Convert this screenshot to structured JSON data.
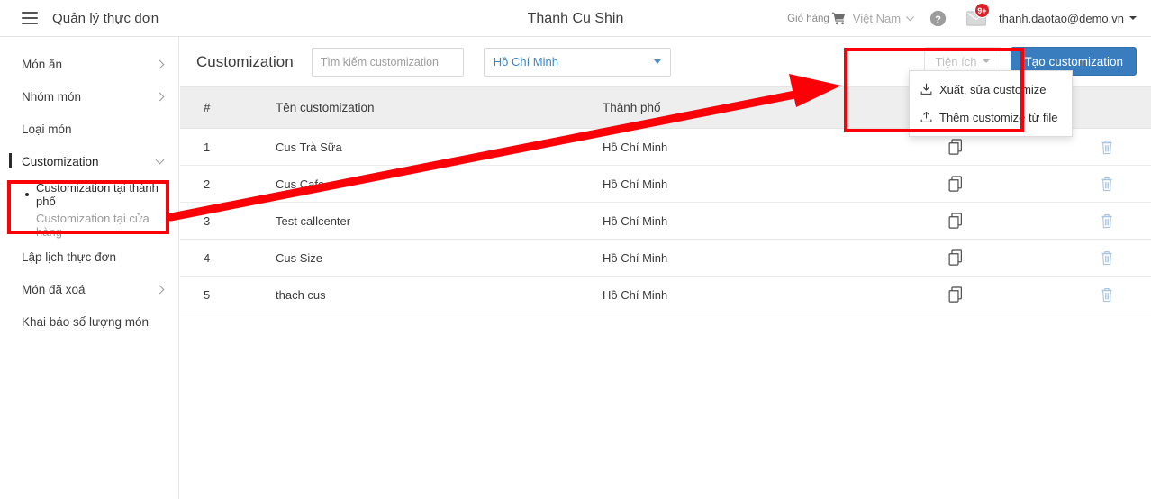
{
  "topbar": {
    "menu_icon": "hamburger-icon",
    "app_title": "Quản lý thực đơn",
    "center_title": "Thanh Cu Shin",
    "cart_label": "Giỏ hàng",
    "cart_icon": "shopping-cart-icon",
    "language": "Việt Nam",
    "lang_caret_icon": "chevron-down-icon",
    "help_icon": "help-circle-icon",
    "mail_icon": "envelope-icon",
    "mail_badge": "9+",
    "user_email": "thanh.daotao@demo.vn",
    "user_caret_icon": "caret-down-icon"
  },
  "sidebar": {
    "items": [
      {
        "label": "Món ăn",
        "expandable": true,
        "state": "collapsed"
      },
      {
        "label": "Nhóm món",
        "expandable": true,
        "state": "collapsed"
      },
      {
        "label": "Loại món",
        "expandable": false,
        "state": "none"
      },
      {
        "label": "Customization",
        "expandable": true,
        "state": "expanded"
      }
    ],
    "subitems": [
      {
        "label": "Customization tại thành phố",
        "selected": true
      },
      {
        "label": "Customization tại cửa hàng",
        "selected": false
      }
    ],
    "items_after": [
      {
        "label": "Lập lịch thực đơn",
        "expandable": false,
        "state": "none"
      },
      {
        "label": "Món đã xoá",
        "expandable": true,
        "state": "collapsed"
      },
      {
        "label": "Khai báo số lượng món",
        "expandable": false,
        "state": "none"
      }
    ]
  },
  "toolbar": {
    "page_heading": "Customization",
    "search_placeholder": "Tìm kiếm customization",
    "search_value": "",
    "search_icon": "magnifier-icon",
    "city_selected": "Hồ Chí Minh",
    "city_caret_icon": "caret-down-icon",
    "util_label": "Tiện ích",
    "util_caret_icon": "caret-down-icon",
    "create_label": "Tạo customization"
  },
  "util_menu": {
    "items": [
      {
        "label": "Xuất, sửa customize",
        "icon": "export-download-icon"
      },
      {
        "label": "Thêm customize từ file",
        "icon": "import-upload-icon"
      }
    ]
  },
  "table": {
    "headers": {
      "index": "#",
      "name": "Tên customization",
      "city": "Thành phố",
      "copy": "",
      "delete": ""
    },
    "rows": [
      {
        "index": "1",
        "name": "Cus Trà Sữa",
        "city": "Hồ Chí Minh",
        "copy_icon": "copy-icon",
        "delete_icon": "trash-icon"
      },
      {
        "index": "2",
        "name": "Cus Cafe",
        "city": "Hồ Chí Minh",
        "copy_icon": "copy-icon",
        "delete_icon": "trash-icon"
      },
      {
        "index": "3",
        "name": "Test callcenter",
        "city": "Hồ Chí Minh",
        "copy_icon": "copy-icon",
        "delete_icon": "trash-icon"
      },
      {
        "index": "4",
        "name": "Cus Size",
        "city": "Hồ Chí Minh",
        "copy_icon": "copy-icon",
        "delete_icon": "trash-icon"
      },
      {
        "index": "5",
        "name": "thach cus",
        "city": "Hồ Chí Minh",
        "copy_icon": "copy-icon",
        "delete_icon": "trash-icon"
      }
    ]
  },
  "annotations": {
    "color": "#fb0007",
    "box_sidebar": "highlight-sidebar-subitems",
    "box_menu": "highlight-utility-menu",
    "arrow": "arrow-pointing-to-utility-menu"
  },
  "colors": {
    "primary_button": "#3a7dbf",
    "link_text": "#3a86c8",
    "badge_red": "#dd1f26",
    "annotation_red": "#fb0007",
    "table_header_bg": "#eeeeee"
  }
}
